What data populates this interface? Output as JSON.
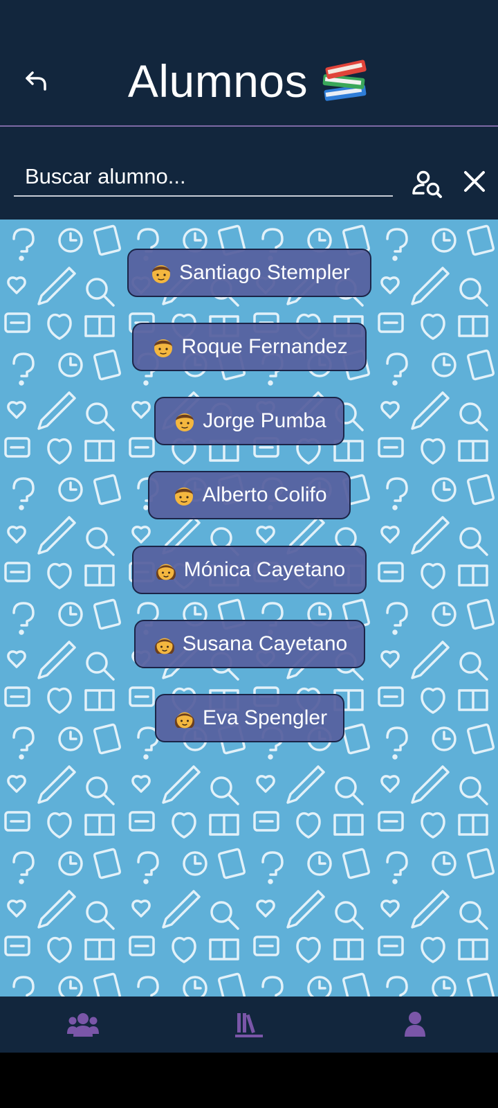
{
  "header": {
    "title": "Alumnos",
    "title_icon": "books-icon",
    "back_icon": "back-arrow-icon"
  },
  "search": {
    "placeholder": "Buscar alumno...",
    "value": "",
    "search_icon": "user-search-icon",
    "clear_icon": "close-icon"
  },
  "students": [
    {
      "name": "Santiago Stempler",
      "avatar": "boy-avatar-icon"
    },
    {
      "name": "Roque Fernandez",
      "avatar": "boy-avatar-icon"
    },
    {
      "name": "Jorge Pumba",
      "avatar": "boy-avatar-icon"
    },
    {
      "name": "Alberto Colifo",
      "avatar": "boy-avatar-icon"
    },
    {
      "name": "Mónica Cayetano",
      "avatar": "girl-avatar-icon"
    },
    {
      "name": "Susana Cayetano",
      "avatar": "girl-avatar-icon"
    },
    {
      "name": "Eva Spengler",
      "avatar": "girl-avatar-icon"
    }
  ],
  "bottom_nav": {
    "items": [
      {
        "icon": "users-group-icon"
      },
      {
        "icon": "library-icon"
      },
      {
        "icon": "user-profile-icon"
      }
    ]
  },
  "colors": {
    "header_bg": "#12263d",
    "divider": "#7d6aa6",
    "content_bg": "#5fb0d8",
    "chip_bg": "#56609e",
    "nav_icon": "#7a56a8"
  }
}
